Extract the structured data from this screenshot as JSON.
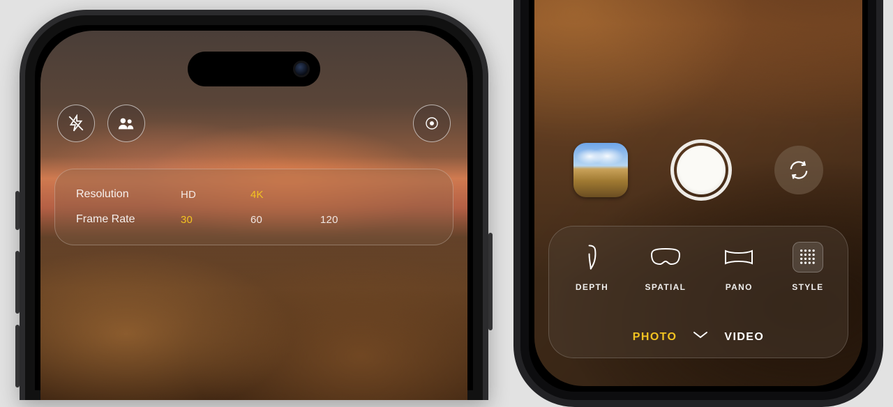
{
  "left": {
    "top_buttons": {
      "flash": "flash-off-icon",
      "people": "people-icon",
      "focus": "target-icon"
    },
    "settings": {
      "resolution_label": "Resolution",
      "resolution_opts": {
        "hd": "HD",
        "4k": "4K"
      },
      "resolution_selected": "4k",
      "framerate_label": "Frame Rate",
      "framerate_opts": {
        "30": "30",
        "60": "60",
        "120": "120"
      },
      "framerate_selected": "30"
    }
  },
  "right": {
    "thumbnail_alt": "last-photo-thumbnail",
    "shutter": "shutter-button",
    "flip": "camera-flip-icon",
    "modes": {
      "depth": "DEPTH",
      "spatial": "SPATIAL",
      "pano": "PANO",
      "style": "STYLE"
    },
    "capture_toggle": {
      "photo": "PHOTO",
      "video": "VIDEO",
      "selected": "photo"
    }
  }
}
